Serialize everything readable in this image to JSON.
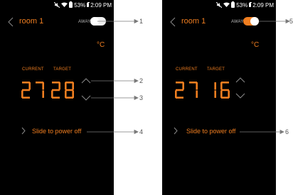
{
  "screens": {
    "left": {
      "status": {
        "battery": "53%",
        "time": "2:09 PM"
      },
      "title": "room 1",
      "away_label": "AWAY",
      "away_on": false,
      "unit": "°C",
      "current_label": "CURRENT",
      "target_label": "TARGET",
      "current_value": "27",
      "target_value": "28",
      "slide_text": "Slide to power off"
    },
    "right": {
      "status": {
        "battery": "53%",
        "time": "2:09 PM"
      },
      "title": "room 1",
      "away_label": "AWAY",
      "away_on": true,
      "unit": "°C",
      "current_label": "CURRENT",
      "target_label": "TARGET",
      "current_value": "27",
      "target_value": "16",
      "slide_text": "Slide to power off"
    }
  },
  "callouts": [
    "1",
    "2",
    "3",
    "4",
    "5",
    "6"
  ],
  "colors": {
    "accent": "#f07e20",
    "background": "#000000",
    "callout_line": "#7a7a7a"
  }
}
